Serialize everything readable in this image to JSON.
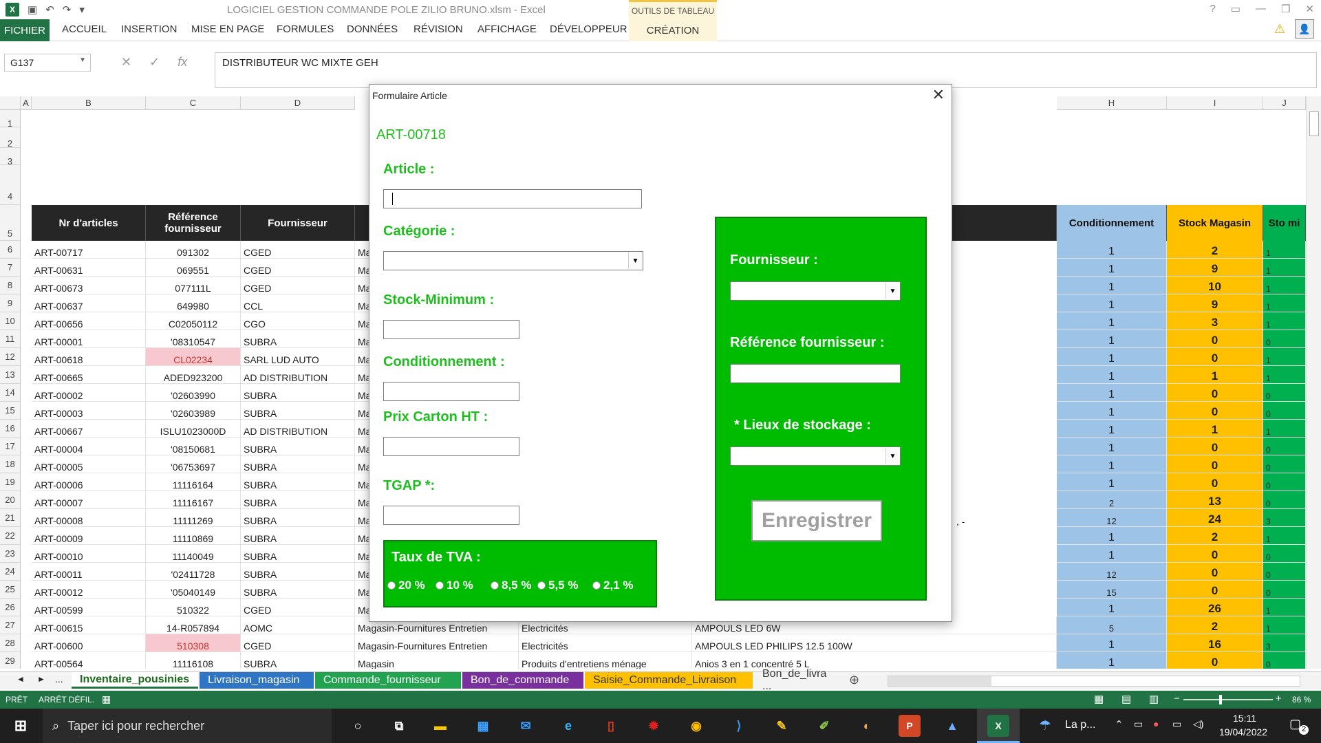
{
  "app": {
    "title": "LOGICIEL GESTION COMMANDE POLE ZILIO BRUNO.xlsm - Excel",
    "context_group": "OUTILS DE TABLEAU",
    "context_tab": "CRÉATION"
  },
  "ribbon": {
    "tabs": [
      "FICHIER",
      "ACCUEIL",
      "INSERTION",
      "MISE EN PAGE",
      "FORMULES",
      "DONNÉES",
      "RÉVISION",
      "AFFICHAGE",
      "DÉVELOPPEUR"
    ]
  },
  "formula_bar": {
    "name_box": "G137",
    "content": "DISTRIBUTEUR WC MIXTE GEH"
  },
  "columns": [
    "A",
    "B",
    "C",
    "D",
    "H",
    "I",
    "J"
  ],
  "row_numbers": [
    "1",
    "2",
    "3",
    "4",
    "5",
    "6",
    "7",
    "8",
    "9",
    "10",
    "11",
    "12",
    "13",
    "14",
    "15",
    "16",
    "17",
    "18",
    "19",
    "20",
    "21",
    "22",
    "23",
    "24",
    "25",
    "26",
    "27",
    "28",
    "29"
  ],
  "table": {
    "headers": [
      "Nr d'articles",
      "Référence fournisseur",
      "Fournisseur",
      "Conditionnement",
      "Stock Magasin",
      "Sto mi"
    ],
    "rows": [
      {
        "nr": "ART-00717",
        "ref": "091302",
        "four": "CGED",
        "d": "Ma",
        "cond": "1",
        "stock": "2",
        "j": "1",
        "hl": false
      },
      {
        "nr": "ART-00631",
        "ref": "069551",
        "four": "CGED",
        "d": "Ma",
        "cond": "1",
        "stock": "9",
        "j": "1",
        "hl": false
      },
      {
        "nr": "ART-00673",
        "ref": "077111L",
        "four": "CGED",
        "d": "Ma",
        "cond": "1",
        "stock": "10",
        "j": "1",
        "hl": false
      },
      {
        "nr": "ART-00637",
        "ref": "649980",
        "four": "CCL",
        "d": "Ma",
        "cond": "1",
        "stock": "9",
        "j": "1",
        "hl": false
      },
      {
        "nr": "ART-00656",
        "ref": "C02050112",
        "four": "CGO",
        "d": "Ma",
        "cond": "1",
        "stock": "3",
        "j": "1",
        "hl": false
      },
      {
        "nr": "ART-00001",
        "ref": "'08310547",
        "four": "SUBRA",
        "d": "Ma",
        "cond": "1",
        "stock": "0",
        "j": "0",
        "hl": false
      },
      {
        "nr": "ART-00618",
        "ref": "CL02234",
        "four": "SARL LUD AUTO",
        "d": "Ma",
        "cond": "1",
        "stock": "0",
        "j": "1",
        "hl": true
      },
      {
        "nr": "ART-00665",
        "ref": "ADED923200",
        "four": "AD DISTRIBUTION",
        "d": "Ma",
        "cond": "1",
        "stock": "1",
        "j": "1",
        "hl": false
      },
      {
        "nr": "ART-00002",
        "ref": "'02603990",
        "four": "SUBRA",
        "d": "Ma",
        "cond": "1",
        "stock": "0",
        "j": "0",
        "hl": false
      },
      {
        "nr": "ART-00003",
        "ref": "'02603989",
        "four": "SUBRA",
        "d": "Ma",
        "cond": "1",
        "stock": "0",
        "j": "0",
        "hl": false
      },
      {
        "nr": "ART-00667",
        "ref": "ISLU1023000D",
        "four": "AD DISTRIBUTION",
        "d": "Ma",
        "cond": "1",
        "stock": "1",
        "j": "1",
        "hl": false
      },
      {
        "nr": "ART-00004",
        "ref": "'08150681",
        "four": "SUBRA",
        "d": "Ma",
        "cond": "1",
        "stock": "0",
        "j": "0",
        "hl": false
      },
      {
        "nr": "ART-00005",
        "ref": "'06753697",
        "four": "SUBRA",
        "d": "Ma",
        "cond": "1",
        "stock": "0",
        "j": "0",
        "hl": false
      },
      {
        "nr": "ART-00006",
        "ref": "11116164",
        "four": "SUBRA",
        "d": "Ma",
        "cond": "1",
        "stock": "0",
        "j": "0",
        "hl": false
      },
      {
        "nr": "ART-00007",
        "ref": "11116167",
        "four": "SUBRA",
        "d": "Ma",
        "cond": "2",
        "stock": "13",
        "j": "0",
        "hl": false
      },
      {
        "nr": "ART-00008",
        "ref": "11111269",
        "four": "SUBRA",
        "d": "Ma",
        "cond": "12",
        "stock": "24",
        "j": "3",
        "hl": false
      },
      {
        "nr": "ART-00009",
        "ref": "11110869",
        "four": "SUBRA",
        "d": "Ma",
        "cond": "1",
        "stock": "2",
        "j": "1",
        "hl": false
      },
      {
        "nr": "ART-00010",
        "ref": "11140049",
        "four": "SUBRA",
        "d": "Ma",
        "cond": "1",
        "stock": "0",
        "j": "0",
        "hl": false
      },
      {
        "nr": "ART-00011",
        "ref": "'02411728",
        "four": "SUBRA",
        "d": "Ma",
        "cond": "12",
        "stock": "0",
        "j": "0",
        "hl": false
      },
      {
        "nr": "ART-00012",
        "ref": "'05040149",
        "four": "SUBRA",
        "d": "Ma",
        "cond": "15",
        "stock": "0",
        "j": "0",
        "hl": false
      },
      {
        "nr": "ART-00599",
        "ref": "510322",
        "four": "CGED",
        "d": "Ma",
        "cond": "1",
        "stock": "26",
        "j": "1",
        "hl": false
      },
      {
        "nr": "ART-00615",
        "ref": "14-R057894",
        "four": "AOMC",
        "d": "Magasin-Fournitures Entretien",
        "e": "Electricités",
        "f": "AMPOULS LED 6W",
        "cond": "5",
        "stock": "2",
        "j": "1",
        "hl": false
      },
      {
        "nr": "ART-00600",
        "ref": "510308",
        "four": "CGED",
        "d": "Magasin-Fournitures Entretien",
        "e": "Electricités",
        "f": "AMPOULS LED PHILIPS 12.5  100W",
        "cond": "1",
        "stock": "16",
        "j": "3",
        "hl": true
      },
      {
        "nr": "ART-00564",
        "ref": "11116108",
        "four": "SUBRA",
        "d": "Magasin",
        "e": "Produits d'entretiens ménage",
        "f": "Anios 3 en 1 concentré 5 L",
        "cond": "1",
        "stock": "0",
        "j": "0",
        "hl": false
      }
    ],
    "row21_note": ", -"
  },
  "sheets": [
    {
      "label": "Inventaire_pousinies",
      "color": "#ffffff",
      "text": "#1e6b1e"
    },
    {
      "label": "Livraison_magasin",
      "color": "#2e75c6",
      "text": "#ffffff"
    },
    {
      "label": "Commande_fournisseur",
      "color": "#22a350",
      "text": "#ffffff"
    },
    {
      "label": "Bon_de_commande",
      "color": "#7a2f9e",
      "text": "#ffffff"
    },
    {
      "label": "Saisie_Commande_Livraison",
      "color": "#ffc000",
      "text": "#333333"
    },
    {
      "label": "Bon_de_livra ...",
      "color": "#f3f3f3",
      "text": "#333333"
    }
  ],
  "sheet_nav": {
    "prev": "◄",
    "next": "►",
    "more": "..."
  },
  "status": {
    "ready": "PRÊT",
    "scroll": "ARRÊT DÉFIL.",
    "zoom": "86 %"
  },
  "dialog": {
    "title": "Formulaire Article",
    "article_id": "ART-00718",
    "labels": {
      "article": "Article :",
      "categorie": "Catégorie :",
      "stock_min": "Stock-Minimum :",
      "conditionnement": "Conditionnement :",
      "prix": "Prix Carton HT :",
      "tgap": "TGAP *:",
      "tva": "Taux de TVA :",
      "fournisseur": "Fournisseur :",
      "ref_fournisseur": "Référence fournisseur :",
      "lieux": "* Lieux de stockage :"
    },
    "tva_options": [
      "20 %",
      "10 %",
      "8,5 %",
      "5,5 %",
      "2,1 %"
    ],
    "save_button": "Enregistrer"
  },
  "taskbar": {
    "search_placeholder": "Taper ici pour rechercher",
    "weather": "La p...",
    "time": "15:11",
    "date": "19/04/2022",
    "notif_count": "2"
  },
  "colors": {
    "excel_green": "#217346",
    "form_green": "#1fbe1f",
    "panel_green": "#00bc00",
    "cond_blue": "#9dc3e6",
    "stock_orange": "#ffc000",
    "pink": "#f8c8d0"
  }
}
